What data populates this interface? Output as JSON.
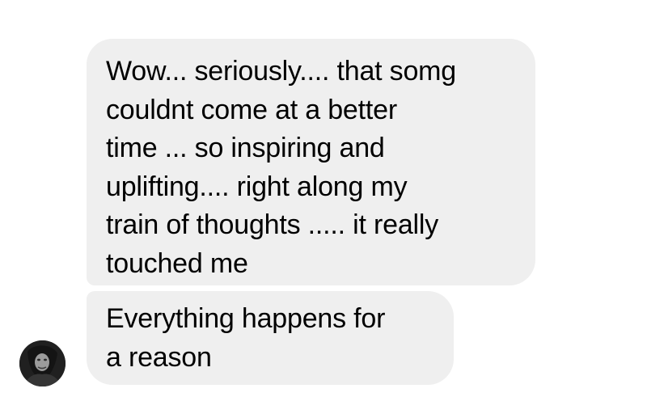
{
  "thread": {
    "messages": [
      {
        "text": "Wow... seriously.... that somg\ncouldnt come at a better\ntime ... so inspiring and\nuplifting.... right along my\ntrain of thoughts ..... it really\ntouched me"
      },
      {
        "text": "Everything happens for\na reason"
      }
    ],
    "avatar": {
      "icon": "profile-photo",
      "description_color": "#2a2a2a"
    }
  },
  "colors": {
    "bubble_background": "#efefef",
    "text": "#000000",
    "background": "#ffffff"
  }
}
